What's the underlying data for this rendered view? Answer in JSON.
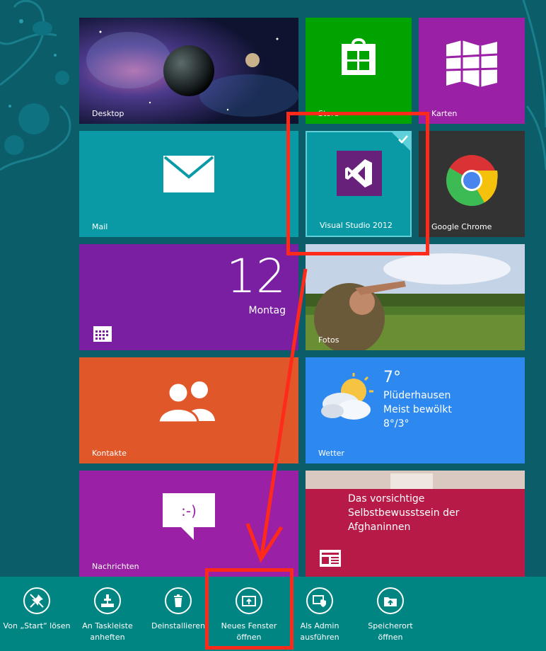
{
  "tiles": {
    "desktop": {
      "label": "Desktop"
    },
    "store": {
      "label": "Store"
    },
    "maps": {
      "label": "Karten"
    },
    "mail": {
      "label": "Mail"
    },
    "visual_studio": {
      "label": "Visual Studio 2012",
      "selected": true
    },
    "chrome": {
      "label": "Google Chrome"
    },
    "calendar": {
      "day_number": "12",
      "weekday": "Montag"
    },
    "photos": {
      "label": "Fotos"
    },
    "contacts": {
      "label": "Kontakte"
    },
    "weather": {
      "label": "Wetter",
      "temperature": "7°",
      "city": "Plüderhausen",
      "condition": "Meist bewölkt",
      "range": "8°/3°"
    },
    "messaging": {
      "label": "Nachrichten"
    },
    "news": {
      "headline_lines": [
        "Das vorsichtige",
        "Selbstbewusstsein der",
        "Afghaninnen"
      ]
    }
  },
  "app_bar": {
    "buttons": [
      {
        "id": "unpin",
        "label_lines": [
          "Von „Start“ lösen"
        ],
        "icon": "unpin-icon"
      },
      {
        "id": "pin-taskbar",
        "label_lines": [
          "An Taskleiste",
          "anheften"
        ],
        "icon": "pin-taskbar-icon"
      },
      {
        "id": "uninstall",
        "label_lines": [
          "Deinstallieren"
        ],
        "icon": "trash-icon"
      },
      {
        "id": "new-window",
        "label_lines": [
          "Neues Fenster",
          "öffnen"
        ],
        "icon": "new-window-icon"
      },
      {
        "id": "run-admin",
        "label_lines": [
          "Als Admin",
          "ausführen"
        ],
        "icon": "shield-icon"
      },
      {
        "id": "open-location",
        "label_lines": [
          "Speicherort",
          "öffnen"
        ],
        "icon": "folder-icon"
      }
    ]
  },
  "colors": {
    "background": "#0b5d6a",
    "app_bar": "#008582",
    "annotation": "#ff2a1a",
    "teal_tile": "#0a9aa6",
    "purple_tile": "#7b1fa2",
    "orange_tile": "#e0572a",
    "green_tile": "#00a300",
    "magenta_tile": "#9a20a6",
    "blue_tile": "#2d89ef",
    "news_tile": "#b81a48"
  }
}
